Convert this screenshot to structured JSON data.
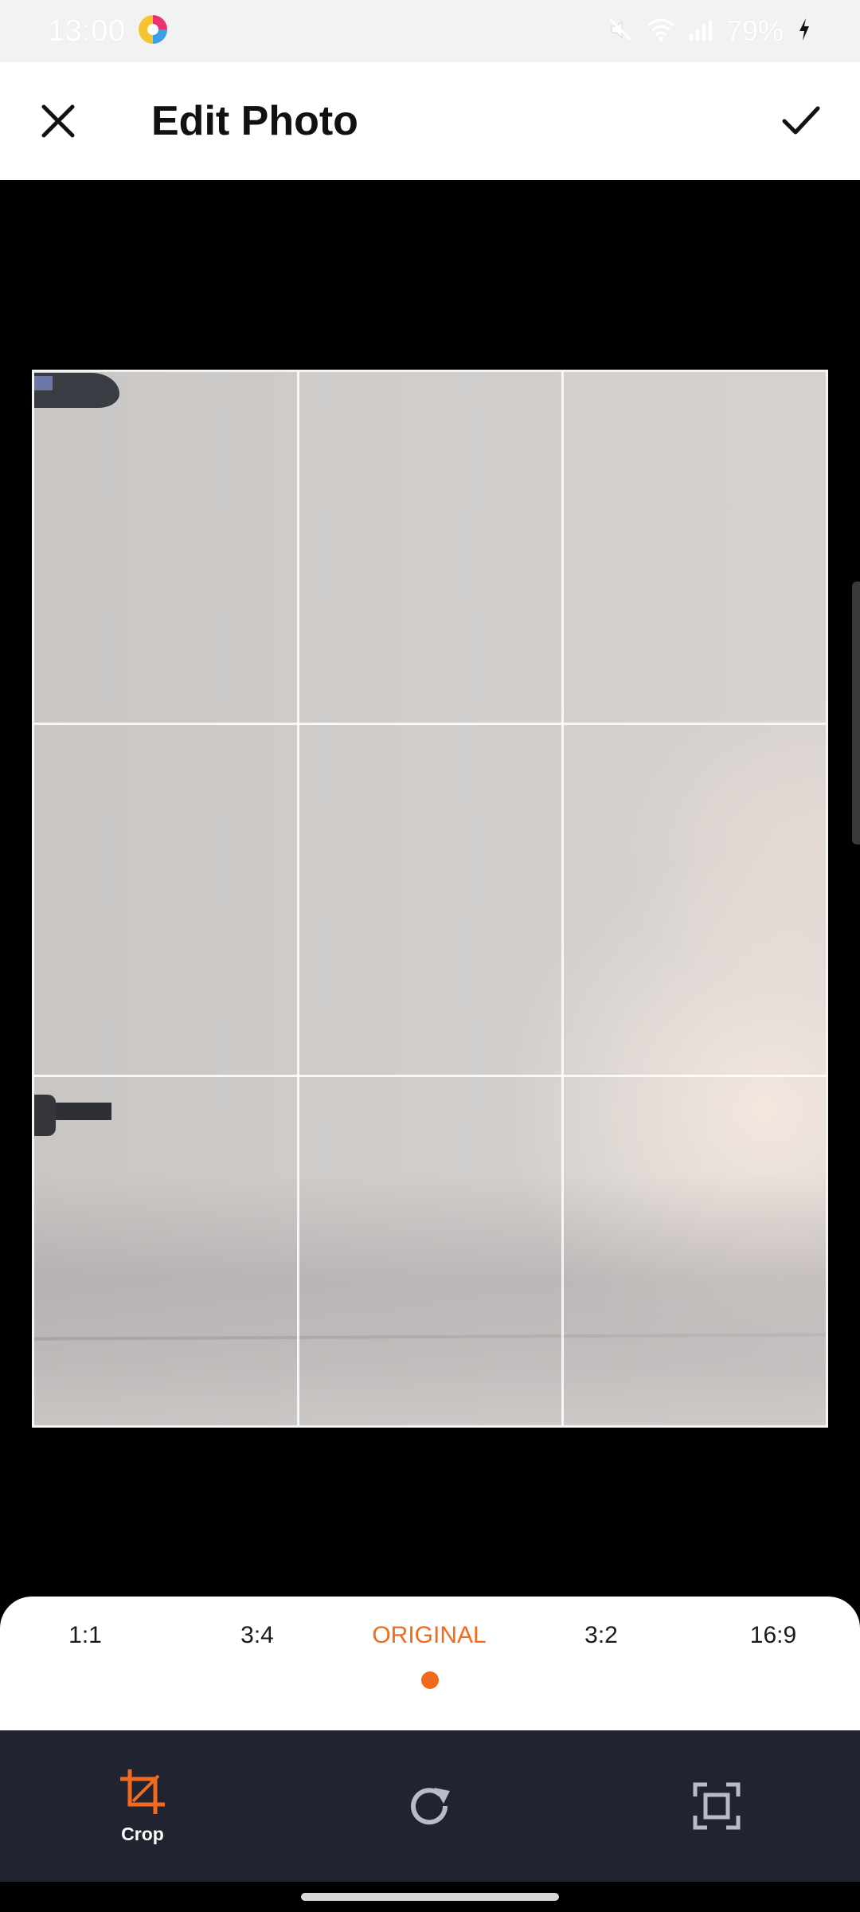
{
  "status_bar": {
    "time": "13:00",
    "battery": "79%",
    "icons": [
      "app-logo-icon",
      "mute-icon",
      "wifi-icon",
      "signal-icon",
      "charging-icon"
    ]
  },
  "header": {
    "title": "Edit Photo",
    "close_icon": "close-icon",
    "confirm_icon": "check-icon"
  },
  "aspect_ratios": {
    "options": [
      {
        "label": "1:1",
        "selected": false
      },
      {
        "label": "3:4",
        "selected": false
      },
      {
        "label": "ORIGINAL",
        "selected": true
      },
      {
        "label": "3:2",
        "selected": false
      },
      {
        "label": "16:9",
        "selected": false
      }
    ]
  },
  "toolbar": {
    "tools": [
      {
        "name": "crop",
        "label": "Crop",
        "icon": "crop-icon",
        "active": true
      },
      {
        "name": "rotate",
        "label": "",
        "icon": "rotate-icon",
        "active": false
      },
      {
        "name": "fit",
        "label": "",
        "icon": "fit-screen-icon",
        "active": false
      }
    ]
  },
  "colors": {
    "accent": "#f26a1b",
    "toolbar_bg": "#212430",
    "header_bg": "#ffffff",
    "status_bg": "#f2f2f2"
  }
}
